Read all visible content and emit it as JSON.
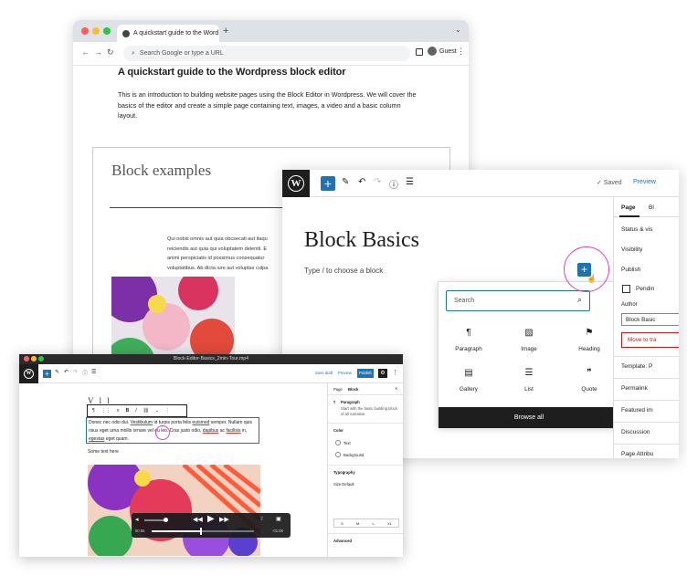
{
  "browser": {
    "tab_title": "A quickstart guide to the Word",
    "tab_close": "✕",
    "new_tab": "+",
    "omnibox_placeholder": "Search Google or type a URL",
    "profile_label": "Guest",
    "page": {
      "heading": "A quickstart guide to the Wordpress block editor",
      "intro": "This is an introduction to building website pages using the Block Editor in Wordpress. We will cover the basics of the editor and create a simple page containing text, images, a video and a basic column layout.",
      "embed_title": "Block examples",
      "embed_text_lines": [
        "Qui nobis omnis aut quia obcsecati aut itaqu",
        "reiciendis aut quia qui voluptatem deleniti. E",
        "animi perspiciatis id possimus consequatur",
        "voluptatibus. Ab dicta iure aut voluptas culpa"
      ]
    }
  },
  "editor": {
    "saved_label": "✓ Saved",
    "preview_label": "Preview",
    "page_title": "Block Basics",
    "placeholder": "Type / to choose a block",
    "inserter": {
      "search_placeholder": "Search",
      "blocks": [
        {
          "label": "Paragraph",
          "glyph": "¶"
        },
        {
          "label": "Image",
          "glyph": "▨"
        },
        {
          "label": "Heading",
          "glyph": "⚑"
        },
        {
          "label": "Gallery",
          "glyph": "▤"
        },
        {
          "label": "List",
          "glyph": "☰"
        },
        {
          "label": "Quote",
          "glyph": "❞"
        }
      ],
      "browse_all": "Browse all"
    },
    "sidebar": {
      "tab_page": "Page",
      "tab_block": "Bl",
      "status_label": "Status & vis",
      "visibility": "Visibility",
      "publish": "Publish",
      "pending": "Pendin",
      "author_label": "Author",
      "author_value": "Block Basic",
      "move_to_trash": "Move to tra",
      "template": "Template: P",
      "permalink": "Permalink",
      "featured_image": "Featured im",
      "discussion": "Discussion",
      "page_attributes": "Page Attribu"
    }
  },
  "video": {
    "file_title": "Block-Editor-Basics_2min-Tour.mp4",
    "toolbar": {
      "save_draft": "Save draft",
      "preview": "Preview",
      "publish": "Publish"
    },
    "content": {
      "heading_fragment": "V       l     l",
      "paragraph_parts": [
        "Donec nec odio dui. ",
        "Vestibulum",
        " id turpis porta felis ",
        "euismod",
        " semper. Nullam quis risus eget urna mollis ornare vel eu leo. Cras justo odio, ",
        "dapibus",
        " ac ",
        "facilisis",
        " in, ",
        "egestas",
        " eget quam."
      ],
      "some_text": "Some text here"
    },
    "sidebar": {
      "tab_page": "Page",
      "tab_block": "Block",
      "block_name": "Paragraph",
      "block_desc": "Start with the basic building block of all narrative.",
      "color": "Color",
      "text": "Text",
      "background": "Background",
      "typography": "Typography",
      "size": "Size Default",
      "size_options": [
        "S",
        "M",
        "L",
        "XL"
      ],
      "advanced": "Advanced"
    },
    "player": {
      "elapsed": "00:55",
      "remaining": "-01:08",
      "progress": 0.48,
      "volume": 0.9
    }
  },
  "colors": {
    "accent": "#2271b1",
    "highlight_ring": "#e83fae",
    "dark": "#1e1e1e"
  }
}
